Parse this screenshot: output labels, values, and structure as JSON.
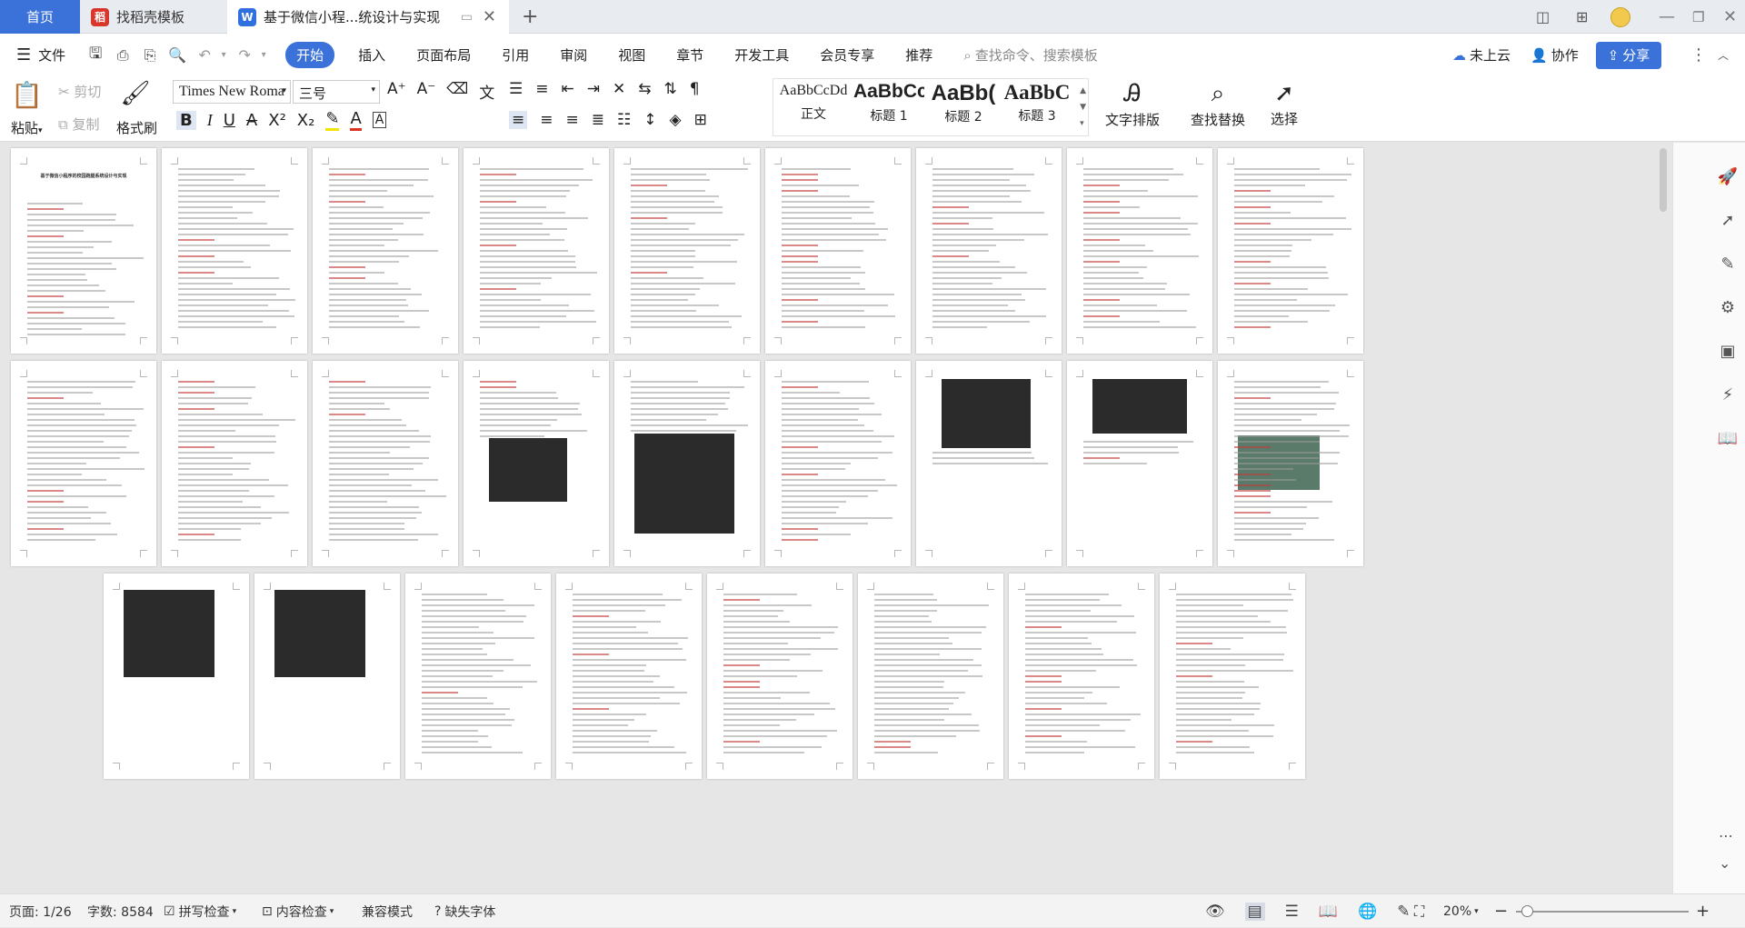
{
  "tabs": {
    "home": "首页",
    "template": "找稻壳模板",
    "doc": "基于微信小程...统设计与实现"
  },
  "menu": {
    "file": "文件",
    "items": [
      "开始",
      "插入",
      "页面布局",
      "引用",
      "审阅",
      "视图",
      "章节",
      "开发工具",
      "会员专享",
      "推荐"
    ],
    "active": "开始",
    "search_placeholder": "查找命令、搜索模板",
    "cloud": "未上云",
    "collab": "协作",
    "share": "分享"
  },
  "ribbon": {
    "paste": "粘贴",
    "cut": "剪切",
    "copy": "复制",
    "format_painter": "格式刷",
    "font": "Times New Roma",
    "size": "三号",
    "styles": [
      {
        "sample": "AaBbCcDd",
        "name": "正文"
      },
      {
        "sample": "AaBbCc",
        "name": "标题 1"
      },
      {
        "sample": "AaBb(",
        "name": "标题 2"
      },
      {
        "sample": "AaBbC",
        "name": "标题 3"
      }
    ],
    "text_layout": "文字排版",
    "find_replace": "查找替换",
    "select": "选择"
  },
  "pages": {
    "page1_title": "基于微信小程序的校园跑腿系统设计与实现"
  },
  "status": {
    "page": "页面: 1/26",
    "words": "字数: 8584",
    "spell": "拼写检查",
    "content_check": "内容检查",
    "compat": "兼容模式",
    "missing_font": "缺失字体",
    "zoom": "20%"
  },
  "colors": {
    "accent": "#3b72d9",
    "wps_red": "#d9352b",
    "doc_blue": "#2f6fe0"
  }
}
